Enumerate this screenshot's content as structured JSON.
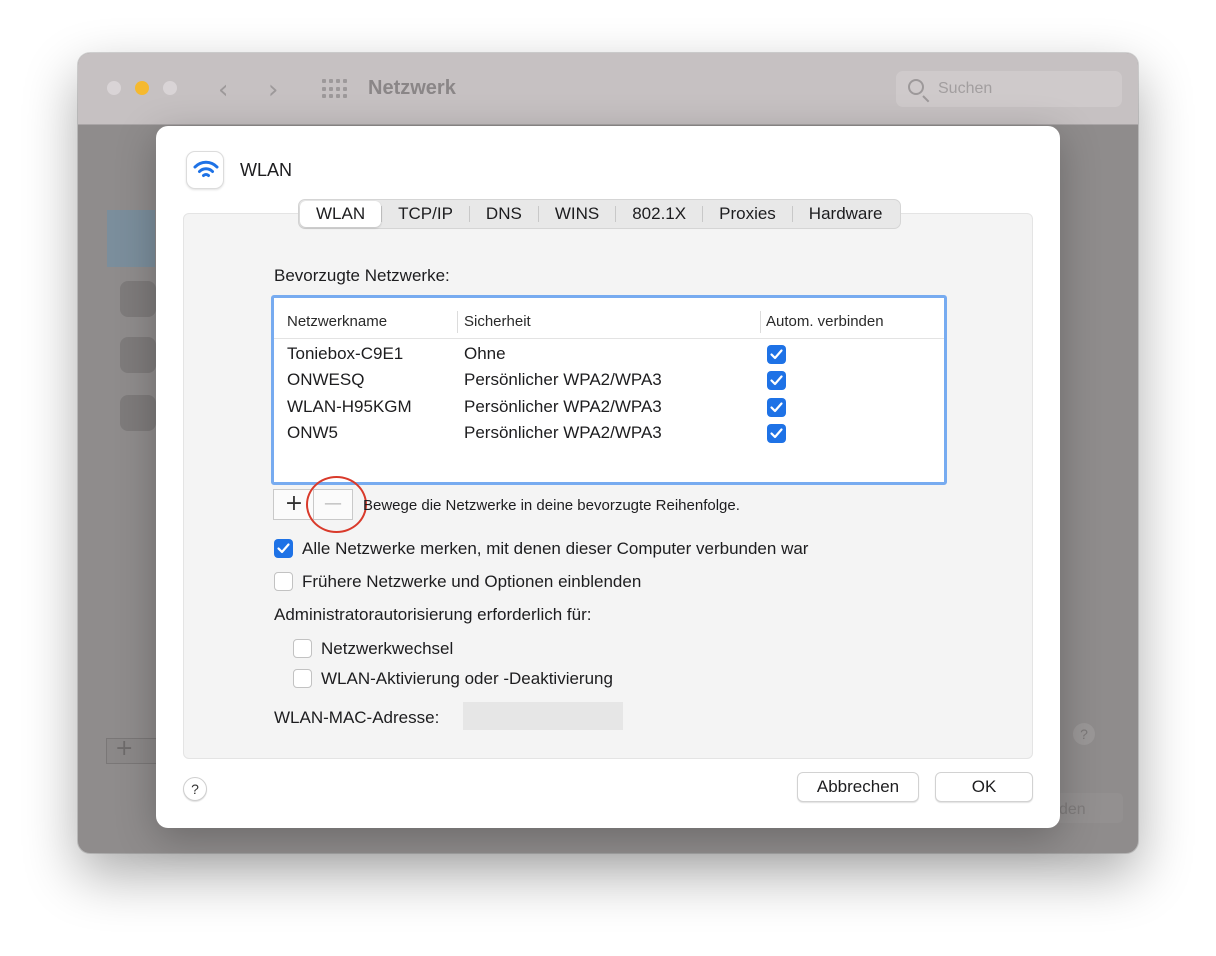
{
  "background_window": {
    "title": "Netzwerk",
    "search_placeholder": "Suchen",
    "partial_button_text": "den",
    "help_label": "?",
    "plus_label": "+"
  },
  "sheet": {
    "title": "WLAN",
    "tabs": [
      {
        "label": "WLAN",
        "active": true
      },
      {
        "label": "TCP/IP"
      },
      {
        "label": "DNS"
      },
      {
        "label": "WINS"
      },
      {
        "label": "802.1X"
      },
      {
        "label": "Proxies"
      },
      {
        "label": "Hardware"
      }
    ],
    "preferred_label": "Bevorzugte Netzwerke:",
    "table": {
      "columns": [
        "Netzwerkname",
        "Sicherheit",
        "Autom. verbinden"
      ],
      "rows": [
        {
          "name": "Toniebox-C9E1",
          "security": "Ohne",
          "auto": true
        },
        {
          "name": "ONWESQ",
          "security": "Persönlicher WPA2/WPA3",
          "auto": true
        },
        {
          "name": "WLAN-H95KGM",
          "security": "Persönlicher WPA2/WPA3",
          "auto": true
        },
        {
          "name": "ONW5",
          "security": "Persönlicher WPA2/WPA3",
          "auto": true
        }
      ]
    },
    "plus_label": "+",
    "minus_label": "—",
    "drag_hint": "Bewege die Netzwerke in deine bevorzugte Reihenfolge.",
    "remember_label": "Alle Netzwerke merken, mit denen dieser Computer verbunden war",
    "remember_checked": true,
    "show_legacy_label": "Frühere Netzwerke und Optionen einblenden",
    "show_legacy_checked": false,
    "admin_label": "Administratorautorisierung erforderlich für:",
    "admin_network_change_label": "Netzwerkwechsel",
    "admin_network_change_checked": false,
    "admin_wlan_toggle_label": "WLAN-Aktivierung oder -Deaktivierung",
    "admin_wlan_toggle_checked": false,
    "mac_label": "WLAN-MAC-Adresse:",
    "help_label": "?",
    "cancel_label": "Abbrechen",
    "ok_label": "OK"
  },
  "colors": {
    "accent": "#1e72e6",
    "table_focus_ring": "#77abf0",
    "annotation_circle": "#d93a2b",
    "minimize_button": "#f5b92f"
  }
}
